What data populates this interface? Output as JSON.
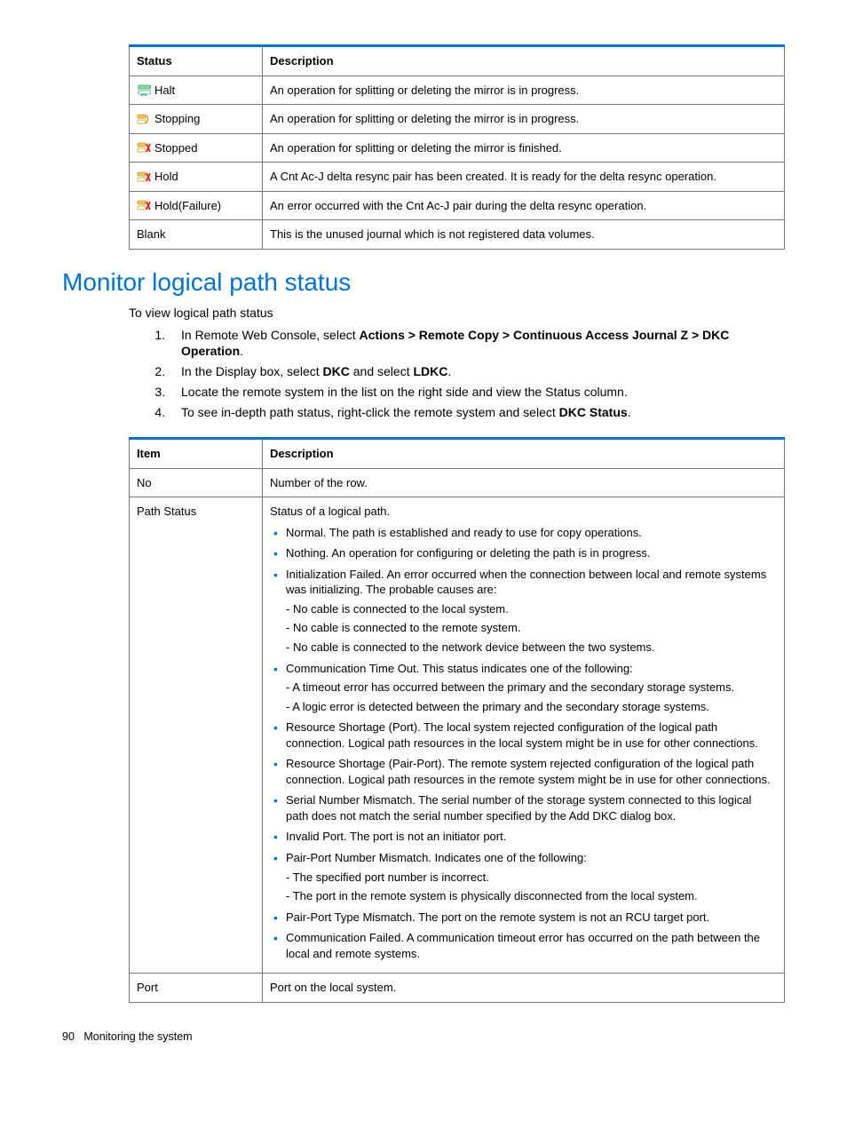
{
  "table1": {
    "headers": {
      "c1": "Status",
      "c2": "Description"
    },
    "rows": [
      {
        "status": "Halt",
        "icon": "halt",
        "desc": "An operation for splitting or deleting the mirror is in progress."
      },
      {
        "status": "Stopping",
        "icon": "stopping",
        "desc": "An operation for splitting or deleting the mirror is in progress."
      },
      {
        "status": "Stopped",
        "icon": "stopped",
        "desc": "An operation for splitting or deleting the mirror is finished."
      },
      {
        "status": "Hold",
        "icon": "hold",
        "desc": "A Cnt Ac-J delta resync pair has been created. It is ready for the delta resync operation."
      },
      {
        "status": "Hold(Failure)",
        "icon": "holdfail",
        "desc": "An error occurred with the Cnt Ac-J pair during the delta resync operation."
      },
      {
        "status": "Blank",
        "icon": "",
        "desc": "This is the unused journal which is not registered data volumes."
      }
    ]
  },
  "section": {
    "title": "Monitor logical path status",
    "intro": "To view logical path status",
    "steps": {
      "s1a": "In Remote Web Console, select ",
      "s1b": "Actions > Remote Copy > Continuous Access Journal Z > DKC Operation",
      "s1c": ".",
      "s2a": "In the Display box, select ",
      "s2b": "DKC",
      "s2c": " and select ",
      "s2d": "LDKC",
      "s2e": ".",
      "s3": "Locate the remote system in the list on the right side and view the Status column.",
      "s4a": "To see in-depth path status, right-click the remote system and select ",
      "s4b": "DKC Status",
      "s4c": "."
    }
  },
  "table2": {
    "headers": {
      "c1": "Item",
      "c2": "Description"
    },
    "row_no": {
      "item": "No",
      "desc": "Number of the row."
    },
    "row_ps": {
      "item": "Path Status",
      "lead": "Status of a logical path.",
      "b1": "Normal. The path is established and ready to use for copy operations.",
      "b2": "Nothing. An operation for configuring or deleting the path is in progress.",
      "b3": "Initialization Failed. An error occurred when the connection between local and remote systems was initializing. The probable causes are:",
      "b3s1": "- No cable is connected to the local system.",
      "b3s2": "- No cable is connected to the remote system.",
      "b3s3": "- No cable is connected to the network device between the two systems.",
      "b4": "Communication Time Out. This status indicates one of the following:",
      "b4s1": "- A timeout error has occurred between the primary and the secondary storage systems.",
      "b4s2": "- A logic error is detected between the primary and the secondary storage systems.",
      "b5": "Resource Shortage (Port). The local system rejected configuration of the logical path connection. Logical path resources in the local system might be in use for other connections.",
      "b6": "Resource Shortage (Pair-Port). The remote system rejected configuration of the logical path connection. Logical path resources in the remote system might be in use for other connections.",
      "b7": "Serial Number Mismatch. The serial number of the storage system connected to this logical path does not match the serial number specified by the Add DKC dialog box.",
      "b8": "Invalid Port. The port is not an initiator port.",
      "b9": "Pair-Port Number Mismatch. Indicates one of the following:",
      "b9s1": "- The specified port number is incorrect.",
      "b9s2": "- The port in the remote system is physically disconnected from the local system.",
      "b10": "Pair-Port Type Mismatch. The port on the remote system is not an RCU target port.",
      "b11": "Communication Failed. A communication timeout error has occurred on the path between the local and remote systems."
    },
    "row_port": {
      "item": "Port",
      "desc": "Port on the local system."
    }
  },
  "footer": {
    "page": "90",
    "title": "Monitoring the system"
  }
}
